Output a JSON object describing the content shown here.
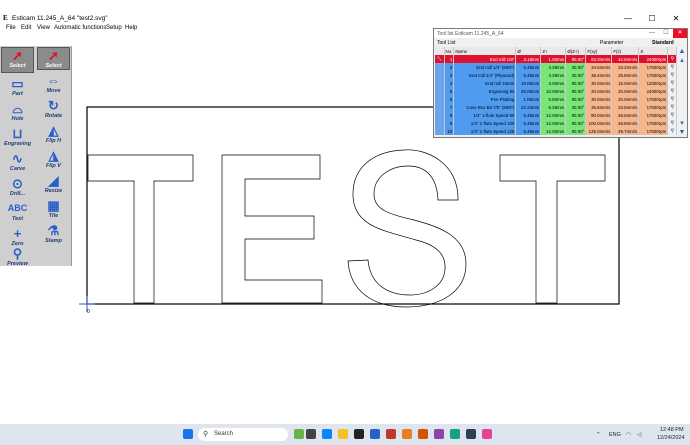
{
  "window": {
    "title": "Estlcam 11.245_A_64 \"test2.svg\"",
    "app_icon": "E",
    "controls": [
      "—",
      "☐",
      "✕"
    ]
  },
  "menu": [
    "File",
    "Edit",
    "View",
    "Automatic functions",
    "Setup",
    "Help"
  ],
  "toolbar": {
    "items": [
      {
        "label": "Select",
        "icon": "cursor-icon",
        "glyph": "➚"
      },
      {
        "label": "Select",
        "icon": "cursor-icon",
        "glyph": "➚"
      },
      {
        "label": "Part",
        "icon": "part-icon",
        "glyph": "▭"
      },
      {
        "label": "Move",
        "icon": "move-icon",
        "glyph": "⇔"
      },
      {
        "label": "Hole",
        "icon": "hole-icon",
        "glyph": "⌓"
      },
      {
        "label": "Rotate",
        "icon": "rotate-icon",
        "glyph": "↻"
      },
      {
        "label": "Engraving",
        "icon": "engraving-icon",
        "glyph": "⊔"
      },
      {
        "label": "Flip H",
        "icon": "flip-h-icon",
        "glyph": "◭"
      },
      {
        "label": "Carve",
        "icon": "carve-icon",
        "glyph": "∿"
      },
      {
        "label": "Flip V",
        "icon": "flip-v-icon",
        "glyph": "◮"
      },
      {
        "label": "Drill...",
        "icon": "drill-icon",
        "glyph": "⊙"
      },
      {
        "label": "Resize",
        "icon": "resize-icon",
        "glyph": "◢"
      },
      {
        "label": "Text",
        "icon": "text-icon",
        "glyph": "ABC"
      },
      {
        "label": "Tile",
        "icon": "tile-icon",
        "glyph": "▦"
      },
      {
        "label": "Zero",
        "icon": "zero-icon",
        "glyph": "+"
      },
      {
        "label": "Stamp",
        "icon": "stamp-icon",
        "glyph": "⚗"
      },
      {
        "label": "Preview",
        "icon": "preview-icon",
        "glyph": "⚲"
      }
    ]
  },
  "drawing": {
    "origin_label": "0",
    "text_shown": "TEST"
  },
  "toollist": {
    "title": "Tool list Estlcam 11.245_A_64",
    "menu": "Tool List",
    "parameter_label": "Parameter",
    "preset": "Standard",
    "headers": [
      "No.",
      "Name",
      "Ø",
      "Z+",
      "Ø(Z+)",
      "F(xy)",
      "F(z)",
      "S"
    ],
    "rows": [
      {
        "no": "1",
        "name": "End mill 1/8\"",
        "d": "3.18mm",
        "z": "1.00mm",
        "a": "90.00°",
        "fxy": "63.3mm/s",
        "fz": "42.6mm/s",
        "s": "24000rpm",
        "selected": true
      },
      {
        "no": "2",
        "name": "End mill 1/4\" (MDF)",
        "d": "6.35mm",
        "z": "4.39mm",
        "a": "30.00°",
        "fxy": "34.5mm/s",
        "fz": "23.2mm/s",
        "s": "17000rpm"
      },
      {
        "no": "3",
        "name": "End mill 1/4\" (Plywood)",
        "d": "6.35mm",
        "z": "4.39mm",
        "a": "30.00°",
        "fxy": "38.4mm/s",
        "fz": "25.8mm/s",
        "s": "17000rpm"
      },
      {
        "no": "4",
        "name": "End mill 10mm",
        "d": "10.00mm",
        "z": "3.00mm",
        "a": "90.00°",
        "fxy": "30.0mm/s",
        "fz": "15.0mm/s",
        "s": "12000rpm"
      },
      {
        "no": "5",
        "name": "Engraving bit",
        "d": "20.00mm",
        "z": "10.00mm",
        "a": "90.00°",
        "fxy": "20.0mm/s",
        "fz": "20.0mm/s",
        "s": "24000rpm"
      },
      {
        "no": "6",
        "name": "Pen Plotting",
        "d": "1.00mm",
        "z": "0.50mm",
        "a": "90.00°",
        "fxy": "30.0mm/s",
        "fz": "20.0mm/s",
        "s": "17000rpm"
      },
      {
        "no": "7",
        "name": "Cove Box Bit 7/8\" (MDF)",
        "d": "22.23mm",
        "z": "6.35mm",
        "a": "30.00°",
        "fxy": "35.8mm/s",
        "fz": "23.5mm/s",
        "s": "17000rpm"
      },
      {
        "no": "8",
        "name": "1/4\" 1-flute Speed 90",
        "d": "6.35mm",
        "z": "12.00mm",
        "a": "90.00°",
        "fxy": "90.0mm/s",
        "fz": "48.6mm/s",
        "s": "17000rpm"
      },
      {
        "no": "9",
        "name": "1/4\" 1-flute Speed 100",
        "d": "6.35mm",
        "z": "12.00mm",
        "a": "90.00°",
        "fxy": "100.0mm/s",
        "fz": "48.8mm/s",
        "s": "17000rpm"
      },
      {
        "no": "10",
        "name": "1/4\" 1-flute Speed 125",
        "d": "6.35mm",
        "z": "12.00mm",
        "a": "90.00°",
        "fxy": "125.0mm/s",
        "fz": "49.7mm/s",
        "s": "17000rpm"
      }
    ]
  },
  "taskbar": {
    "search_placeholder": "Search",
    "language": "ENG",
    "time": "12:48 PM",
    "date": "12/24/2024"
  },
  "colors": {
    "accent_blue": "#2a5ec8",
    "selected_row": "#e0102f",
    "z_columns": "#79e67a",
    "feed_columns": "#f6b78f",
    "tool_cell": "#4f9bf0"
  }
}
